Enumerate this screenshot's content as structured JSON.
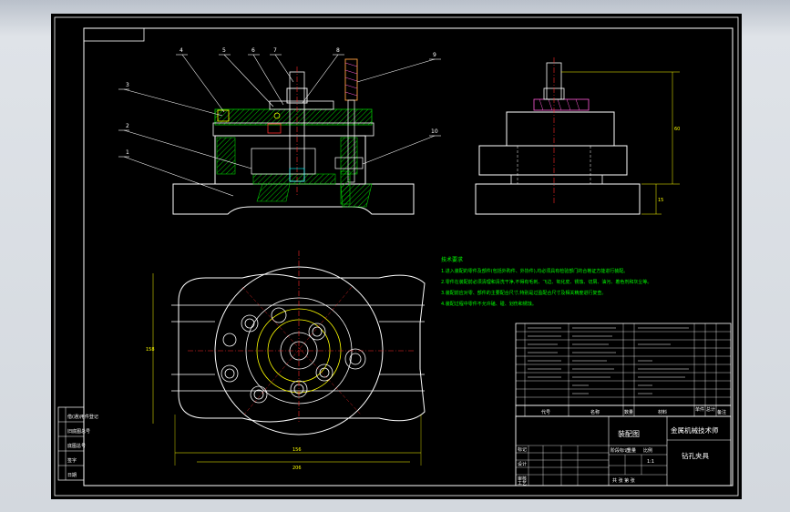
{
  "colors": {
    "background": "#000000",
    "outline": "#ffffff",
    "hatch": "#00c800",
    "accent_yellow": "#ffff00",
    "accent_red": "#ff2a2a",
    "accent_cyan": "#00ffff",
    "dimension_red": "#ff3030",
    "spring_magenta": "#ff5ad6",
    "spring_orange": "#ffa040"
  },
  "balloons": [
    {
      "id": "b1",
      "label": "1"
    },
    {
      "id": "b2",
      "label": "2"
    },
    {
      "id": "b3",
      "label": "3"
    },
    {
      "id": "b4",
      "label": "4"
    },
    {
      "id": "b5",
      "label": "5"
    },
    {
      "id": "b6",
      "label": "6"
    },
    {
      "id": "b7",
      "label": "7"
    },
    {
      "id": "b8",
      "label": "8"
    },
    {
      "id": "b9",
      "label": "9"
    },
    {
      "id": "b10",
      "label": "10"
    }
  ],
  "dimensions": {
    "top_width": "90",
    "side_height": "60",
    "side_small": "15",
    "bottom_width_inner": "156",
    "bottom_width_outer": "206",
    "left_height": "158"
  },
  "technical_requirements": {
    "title": "技术要求",
    "items": [
      "1.进入装配的零件及部件(包括外购件、外协件),均必须具有检验部门的合格证方能进行装配。",
      "2.零件在装配前必须清理和清洗干净,不得有毛刺、飞边、氧化皮、锈蚀、切屑、油污、着色剂和灰尘等。",
      "3.装配前应对零、部件的主要配合尺寸,特别是过盈配合尺寸及相关精度进行复查。",
      "4.装配过程中零件不允许磕、碰、划伤和锈蚀。"
    ]
  },
  "title_block": {
    "drawing_name": "装配图",
    "company": "金属机械技术师",
    "product": "钻孔夹具",
    "scale": "1:1",
    "headers": {
      "code": "代号",
      "name": "名称",
      "qty": "数量",
      "material": "材料",
      "unit_weight": "单件",
      "total_weight": "总计",
      "remark": "备注"
    },
    "approval_rows": [
      "标记",
      "设计",
      "审核",
      "工艺"
    ],
    "stage_labels": [
      "阶段标记",
      "重量",
      "比例"
    ],
    "sheet_label": "共 张 第 张"
  },
  "left_strip": [
    "借(通)用件登记",
    "旧底图总号",
    "底图总号",
    "签字",
    "日期"
  ]
}
